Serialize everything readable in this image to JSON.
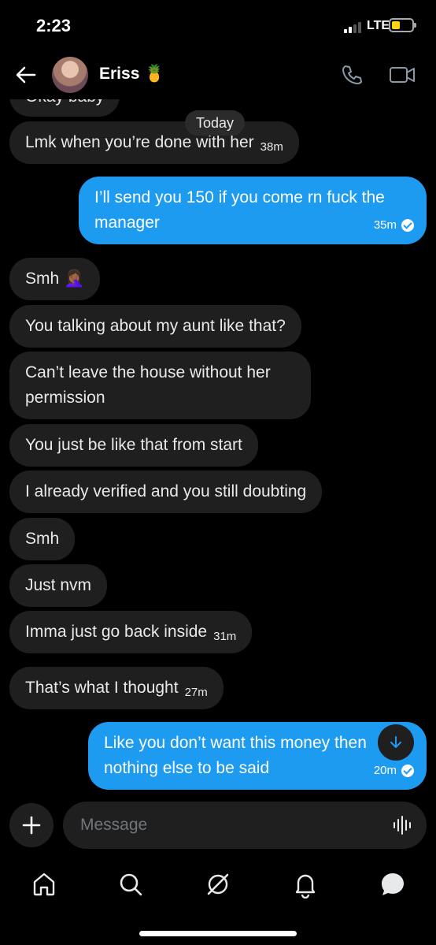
{
  "status": {
    "time": "2:23",
    "network": "LTE"
  },
  "header": {
    "name": "Eriss",
    "name_emoji": "🍍"
  },
  "chat": {
    "partial_top": "Okay baby",
    "day_divider": "Today",
    "messages": [
      {
        "dir": "recv",
        "text": "Lmk when you’re done with her",
        "time": "38m"
      },
      {
        "dir": "sent",
        "text": "I’ll send you 150 if you come rn fuck the manager",
        "time": "35m"
      },
      {
        "dir": "recv",
        "text": "Smh 🤦🏾‍♀️",
        "time": ""
      },
      {
        "dir": "recv",
        "text": "You talking about my aunt like that?",
        "time": ""
      },
      {
        "dir": "recv",
        "text": "Can’t leave the house without her permission",
        "time": ""
      },
      {
        "dir": "recv",
        "text": "You just be like that from start",
        "time": ""
      },
      {
        "dir": "recv",
        "text": "I already verified and you still doubting",
        "time": ""
      },
      {
        "dir": "recv",
        "text": "Smh",
        "time": ""
      },
      {
        "dir": "recv",
        "text": "Just nvm",
        "time": ""
      },
      {
        "dir": "recv",
        "text": "Imma just go back inside",
        "time": "31m"
      },
      {
        "dir": "recv",
        "text": "That’s what I thought",
        "time": "27m"
      },
      {
        "dir": "sent",
        "text": "Like you don’t want this money then nothing else to be said",
        "time": "20m"
      }
    ]
  },
  "composer": {
    "placeholder": "Message"
  },
  "colors": {
    "accent": "#1d9bf0",
    "bubble_received": "#1f1f1f",
    "background": "#000000"
  },
  "tabs": [
    "home-icon",
    "search-icon",
    "grok-icon",
    "notifications-icon",
    "messages-icon"
  ]
}
